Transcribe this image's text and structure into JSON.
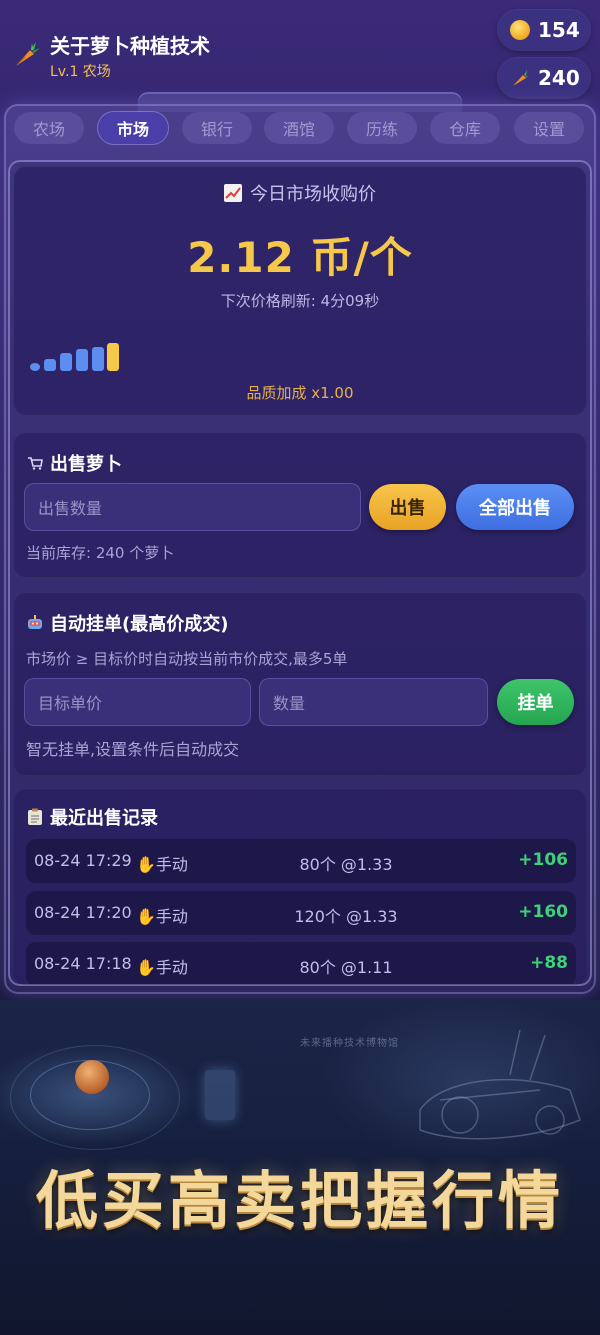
{
  "header": {
    "title": "关于萝卜种植技术",
    "subtitle": "Lv.1 农场",
    "coins": "154",
    "carrots": "240"
  },
  "tabs": [
    {
      "label": "农场",
      "active": false
    },
    {
      "label": "市场",
      "active": true
    },
    {
      "label": "银行",
      "active": false
    },
    {
      "label": "酒馆",
      "active": false
    },
    {
      "label": "历练",
      "active": false
    },
    {
      "label": "仓库",
      "active": false
    },
    {
      "label": "设置",
      "active": false
    }
  ],
  "price": {
    "heading": "今日市场收购价",
    "value": "2.12 币/个",
    "refresh": "下次价格刷新: 4分09秒",
    "quality": "品质加成 x1.00"
  },
  "sell": {
    "title": "出售萝卜",
    "placeholder": "出售数量",
    "sell_label": "出售",
    "sell_all_label": "全部出售",
    "stock": "当前库存: 240 个萝卜"
  },
  "auto": {
    "title": "自动挂单(最高价成交)",
    "desc": "市场价 ≥ 目标价时自动按当前市价成交,最多5单",
    "price_placeholder": "目标单价",
    "qty_placeholder": "数量",
    "order_label": "挂单",
    "empty": "智无挂单,设置条件后自动成交"
  },
  "records": {
    "title": "最近出售记录",
    "items": [
      {
        "time": "08-24 17:29",
        "mode": "手动",
        "qty": "80个 @1.33",
        "gain": "+106"
      },
      {
        "time": "08-24 17:20",
        "mode": "手动",
        "qty": "120个 @1.33",
        "gain": "+160"
      },
      {
        "time": "08-24 17:18",
        "mode": "手动",
        "qty": "80个 @1.11",
        "gain": "+88"
      }
    ]
  },
  "banner": {
    "slogan": "低买高卖把握行情",
    "faint": "未来播种技术博物馆"
  },
  "colors": {
    "accent_gold": "#f5c84a",
    "sell_blue": "#3e6ee0",
    "order_green": "#24a650",
    "gain_green": "#3ed278"
  }
}
